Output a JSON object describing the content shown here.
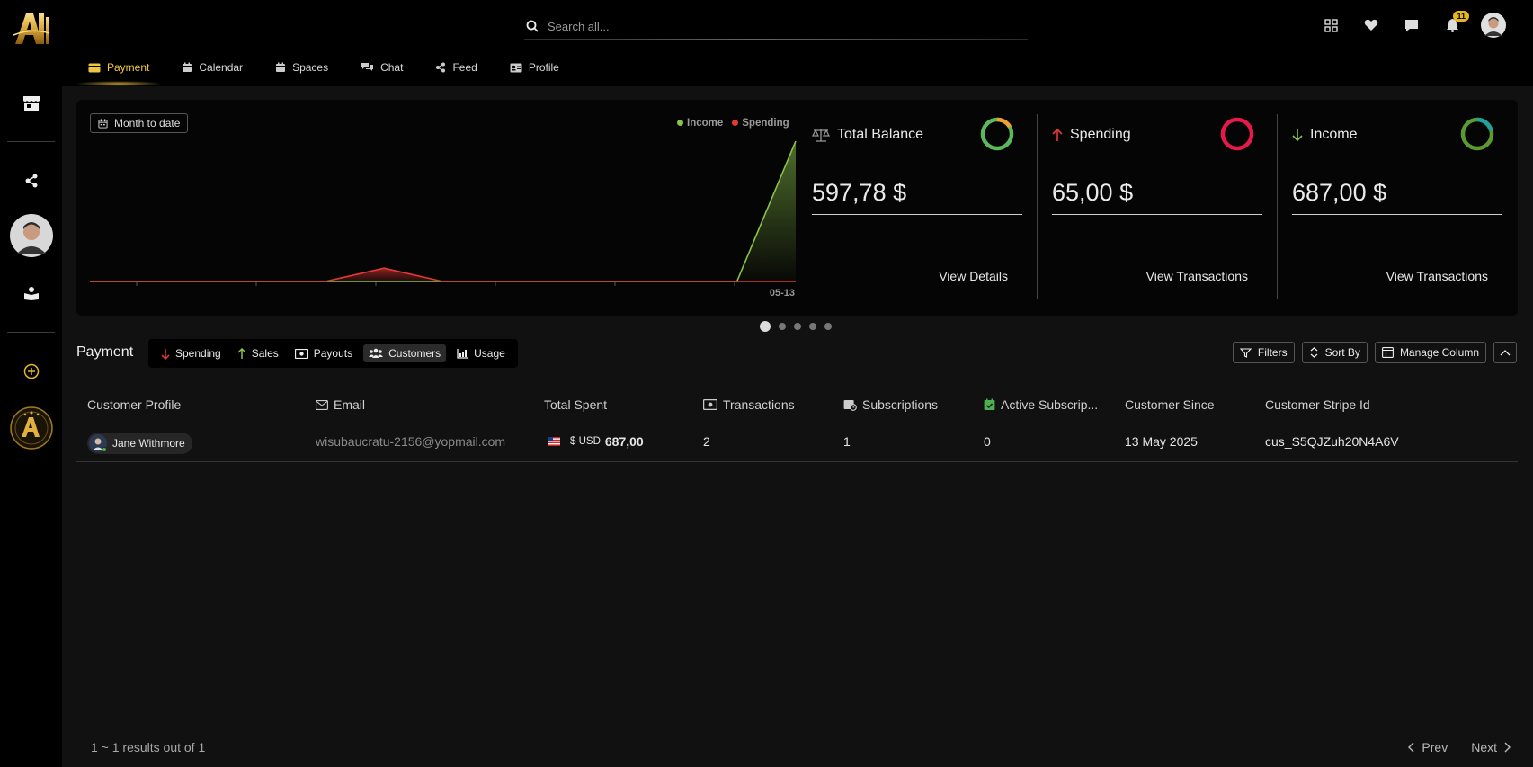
{
  "app": {
    "logo_text": "A"
  },
  "search": {
    "placeholder": "Search all..."
  },
  "header": {
    "notification_count": "11"
  },
  "tabs": [
    {
      "label": "Payment",
      "icon": "credit-card-icon"
    },
    {
      "label": "Calendar",
      "icon": "calendar-icon"
    },
    {
      "label": "Spaces",
      "icon": "calendar-icon"
    },
    {
      "label": "Chat",
      "icon": "chat-icon"
    },
    {
      "label": "Feed",
      "icon": "share-icon"
    },
    {
      "label": "Profile",
      "icon": "id-card-icon"
    }
  ],
  "overview": {
    "range_button": "Month to date",
    "legend": {
      "income": "Income",
      "spending": "Spending"
    },
    "x_label": "05-13",
    "colors": {
      "income": "#8bc34a",
      "spending": "#e53935"
    }
  },
  "chart_data": {
    "type": "area",
    "series": [
      {
        "name": "Income",
        "values": [
          0,
          0,
          0,
          0,
          0,
          0,
          0,
          0,
          0,
          0,
          0,
          0,
          687
        ]
      },
      {
        "name": "Spending",
        "values": [
          0,
          0,
          0,
          0,
          0,
          65,
          0,
          0,
          0,
          0,
          0,
          0,
          0
        ]
      }
    ],
    "x_tick_label": "05-13",
    "legend_position": "top-right",
    "grid": false
  },
  "cards": [
    {
      "title": "Total Balance",
      "value": "597,78 $",
      "link": "View Details",
      "icon": "scale-icon",
      "ring_color": "#5cb85c",
      "ring_accent": "#f0a030"
    },
    {
      "title": "Spending",
      "value": "65,00 $",
      "link": "View Transactions",
      "icon": "arrow-up-icon",
      "ring_color": "#e6194b",
      "ring_accent": "#e6194b"
    },
    {
      "title": "Income",
      "value": "687,00 $",
      "link": "View Transactions",
      "icon": "arrow-down-icon",
      "ring_color": "#5a9a30",
      "ring_accent": "#20a0a0"
    }
  ],
  "carousel": {
    "count": 5,
    "active": 0
  },
  "payment": {
    "title": "Payment",
    "subtabs": [
      {
        "label": "Spending",
        "icon": "arrow-down-icon"
      },
      {
        "label": "Sales",
        "icon": "arrow-up-icon"
      },
      {
        "label": "Payouts",
        "icon": "money-icon"
      },
      {
        "label": "Customers",
        "icon": "users-icon"
      },
      {
        "label": "Usage",
        "icon": "chart-icon"
      }
    ],
    "tools": {
      "filters": "Filters",
      "sort": "Sort By",
      "manage": "Manage Column"
    }
  },
  "table": {
    "columns": [
      "Customer Profile",
      "Email",
      "Total Spent",
      "Transactions",
      "Subscriptions",
      "Active Subscrip...",
      "Customer Since",
      "Customer Stripe Id"
    ],
    "rows": [
      {
        "name": "Jane Withmore",
        "email": "wisubaucratu-2156@yopmail.com",
        "currency_prefix": "$ USD",
        "amount": "687,00",
        "transactions": "2",
        "subscriptions": "1",
        "active": "0",
        "since": "13 May 2025",
        "stripe_id": "cus_S5QJZuh20N4A6V"
      }
    ]
  },
  "footer": {
    "results": "1 ~ 1 results out of 1",
    "prev": "Prev",
    "next": "Next"
  }
}
